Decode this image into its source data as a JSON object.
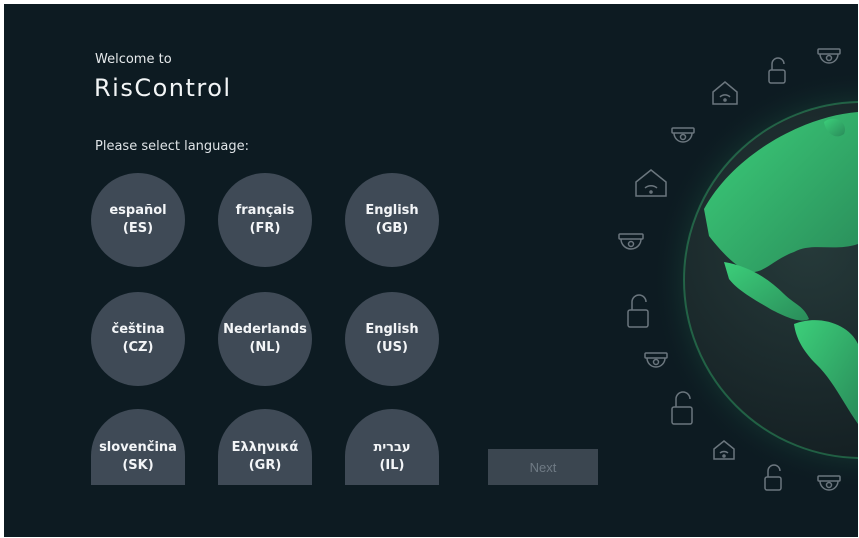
{
  "header": {
    "welcome": "Welcome to",
    "brand": "RisControl",
    "prompt": "Please select language:"
  },
  "languages": [
    {
      "name": "español",
      "code": "(ES)"
    },
    {
      "name": "français",
      "code": "(FR)"
    },
    {
      "name": "English",
      "code": "(GB)"
    },
    {
      "name": "čeština",
      "code": "(CZ)"
    },
    {
      "name": "Nederlands",
      "code": "(NL)"
    },
    {
      "name": "English",
      "code": "(US)"
    },
    {
      "name": "slovenčina",
      "code": "(SK)"
    },
    {
      "name": "Ελληνικά",
      "code": "(GR)"
    },
    {
      "name": "עברית",
      "code": "(IL)"
    }
  ],
  "actions": {
    "next_label": "Next"
  },
  "decor": {
    "icons": [
      "lock-icon",
      "camera-icon",
      "home-wifi-icon"
    ],
    "globe_color": "#3fb56a",
    "background_color": "#0d1b22"
  }
}
